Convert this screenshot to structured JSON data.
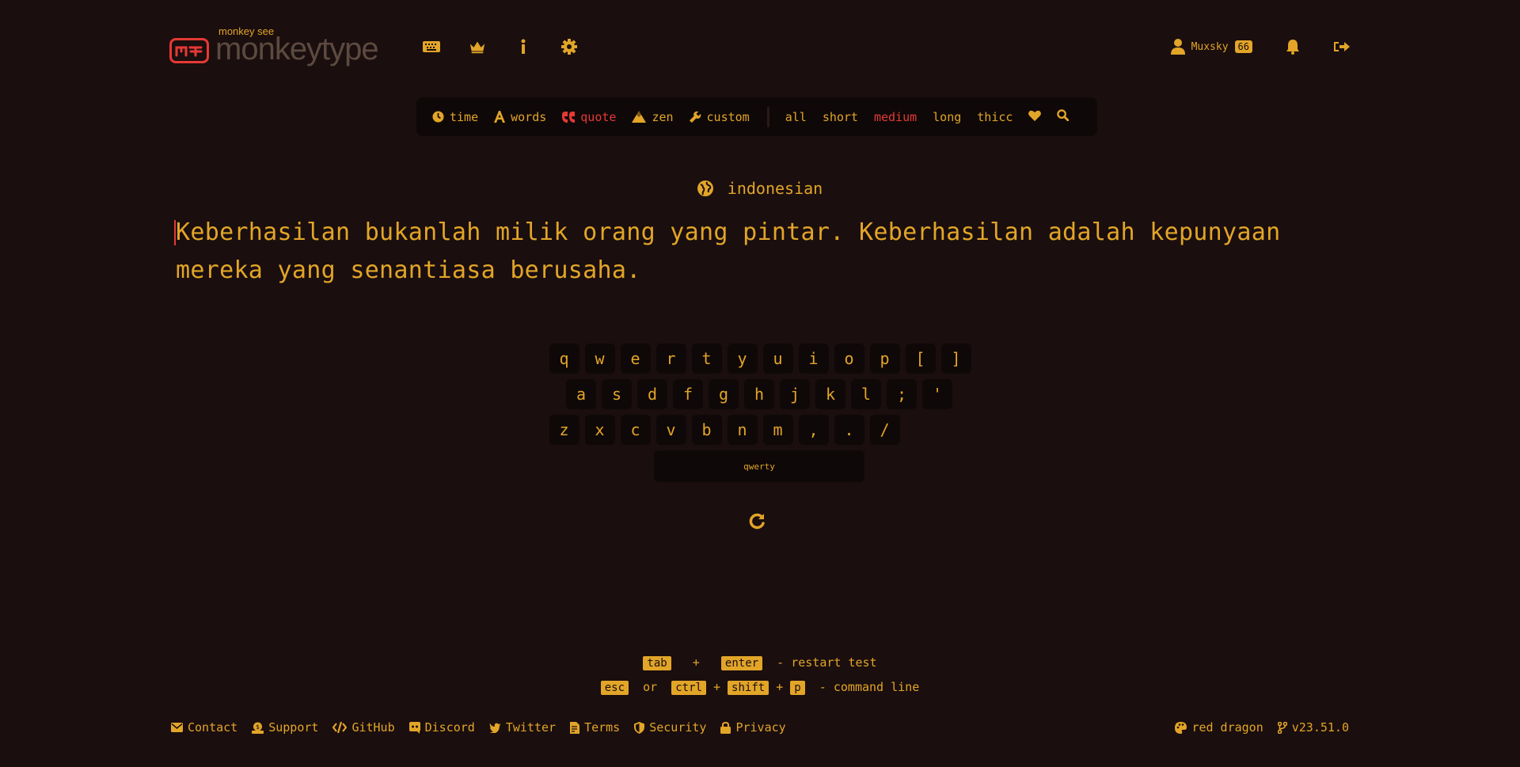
{
  "header": {
    "logo_small": "monkey see",
    "logo_text": "monkeytype",
    "username": "Muxsky",
    "level": "66"
  },
  "mode_bar": {
    "modes": [
      {
        "label": "time",
        "icon": "clock-icon"
      },
      {
        "label": "words",
        "icon": "font-icon"
      },
      {
        "label": "quote",
        "icon": "quote-icon",
        "active": true
      },
      {
        "label": "zen",
        "icon": "mountain-icon"
      },
      {
        "label": "custom",
        "icon": "wrench-icon"
      }
    ],
    "lengths": [
      "all",
      "short",
      "medium",
      "long",
      "thicc"
    ],
    "active_length": "medium"
  },
  "language": "indonesian",
  "quote": "Keberhasilan bukanlah milik orang yang pintar. Keberhasilan adalah kepunyaan mereka yang senantiasa berusaha.",
  "keyboard": {
    "row1": [
      "q",
      "w",
      "e",
      "r",
      "t",
      "y",
      "u",
      "i",
      "o",
      "p",
      "[",
      "]"
    ],
    "row2": [
      "a",
      "s",
      "d",
      "f",
      "g",
      "h",
      "j",
      "k",
      "l",
      ";",
      "'"
    ],
    "row3": [
      "z",
      "x",
      "c",
      "v",
      "b",
      "n",
      "m",
      ",",
      ".",
      "/"
    ],
    "space_label": "qwerty"
  },
  "hints": {
    "tab": "tab",
    "plus": "+",
    "enter": "enter",
    "restart_text": "- restart test",
    "esc": "esc",
    "or": "or",
    "ctrl": "ctrl",
    "shift": "shift",
    "p": "p",
    "command_text": "- command line"
  },
  "footer": {
    "links": [
      "Contact",
      "Support",
      "GitHub",
      "Discord",
      "Twitter",
      "Terms",
      "Security",
      "Privacy"
    ],
    "theme": "red dragon",
    "version": "v23.51.0"
  },
  "colors": {
    "background": "#1a0e0e",
    "main": "#e2a528",
    "accent": "#e53935",
    "sub_bg": "#0f0808"
  }
}
